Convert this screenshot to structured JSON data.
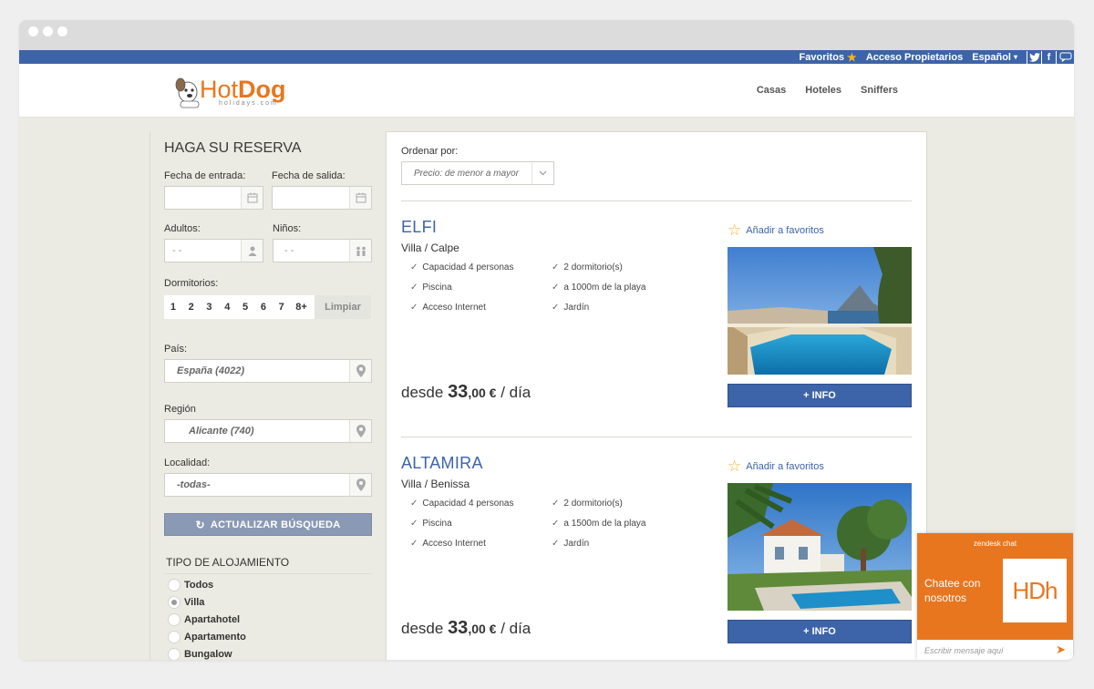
{
  "topbar": {
    "favoritos": "Favoritos",
    "acceso": "Acceso Propietarios",
    "idioma": "Español",
    "social": [
      "twitter-icon",
      "facebook-icon",
      "chat-bubble-icon"
    ]
  },
  "header": {
    "logo_brand_hot": "Hot",
    "logo_brand_dog": "Dog",
    "logo_sub": "holidays.com",
    "nav": [
      "Casas",
      "Hoteles",
      "Sniffers"
    ]
  },
  "sidebar": {
    "title": "HAGA SU RESERVA",
    "checkin_label": "Fecha de entrada:",
    "checkout_label": "Fecha de salida:",
    "adults_label": "Adultos:",
    "adults_value": "- -",
    "kids_label": "Niños:",
    "kids_value": "- -",
    "rooms_label": "Dormitorios:",
    "rooms": [
      "1",
      "2",
      "3",
      "4",
      "5",
      "6",
      "7",
      "8+"
    ],
    "rooms_clear": "Limpiar",
    "country_label": "País:",
    "country_value": "España (4022)",
    "region_label": "Región",
    "region_value": "Alicante (740)",
    "locality_label": "Localidad:",
    "locality_value": "-todas-",
    "update_button": "ACTUALIZAR BÚSQUEDA",
    "tipo_title": "TIPO DE ALOJAMIENTO",
    "tipos": [
      "Todos",
      "Villa",
      "Apartahotel",
      "Apartamento",
      "Bungalow"
    ],
    "tipo_selected": "Villa"
  },
  "results": {
    "sort_label": "Ordenar por:",
    "sort_value": "Precio: de menor a mayor",
    "properties": [
      {
        "name": "ELFI",
        "type": "Villa / Calpe",
        "features_left": [
          "Capacidad 4 personas",
          "Piscina",
          "Acceso Internet"
        ],
        "features_right": [
          "2 dormitorio(s)",
          "a 1000m de la playa",
          "Jardín"
        ],
        "price_prefix": "desde",
        "price_amount": "33",
        "price_cents": ",00 €",
        "price_suffix": "/ día",
        "favorite": "Añadir a favoritos",
        "info_button": "+ INFO"
      },
      {
        "name": "ALTAMIRA",
        "type": "Villa / Benissa",
        "features_left": [
          "Capacidad 4 personas",
          "Piscina",
          "Acceso Internet"
        ],
        "features_right": [
          "2 dormitorio(s)",
          "a 1500m de la playa",
          "Jardín"
        ],
        "price_prefix": "desde",
        "price_amount": "33",
        "price_cents": ",00 €",
        "price_suffix": "/ día",
        "favorite": "Añadir a favoritos",
        "info_button": "+ INFO"
      }
    ]
  },
  "chat": {
    "provider": "zendesk chat",
    "message": "Chatee con nosotros",
    "logo_text": "HDh",
    "placeholder": "Escribir mensaje aquí"
  },
  "colors": {
    "brand_blue": "#3d64a8",
    "accent_orange": "#e8761f",
    "star_yellow": "#f0b428"
  }
}
